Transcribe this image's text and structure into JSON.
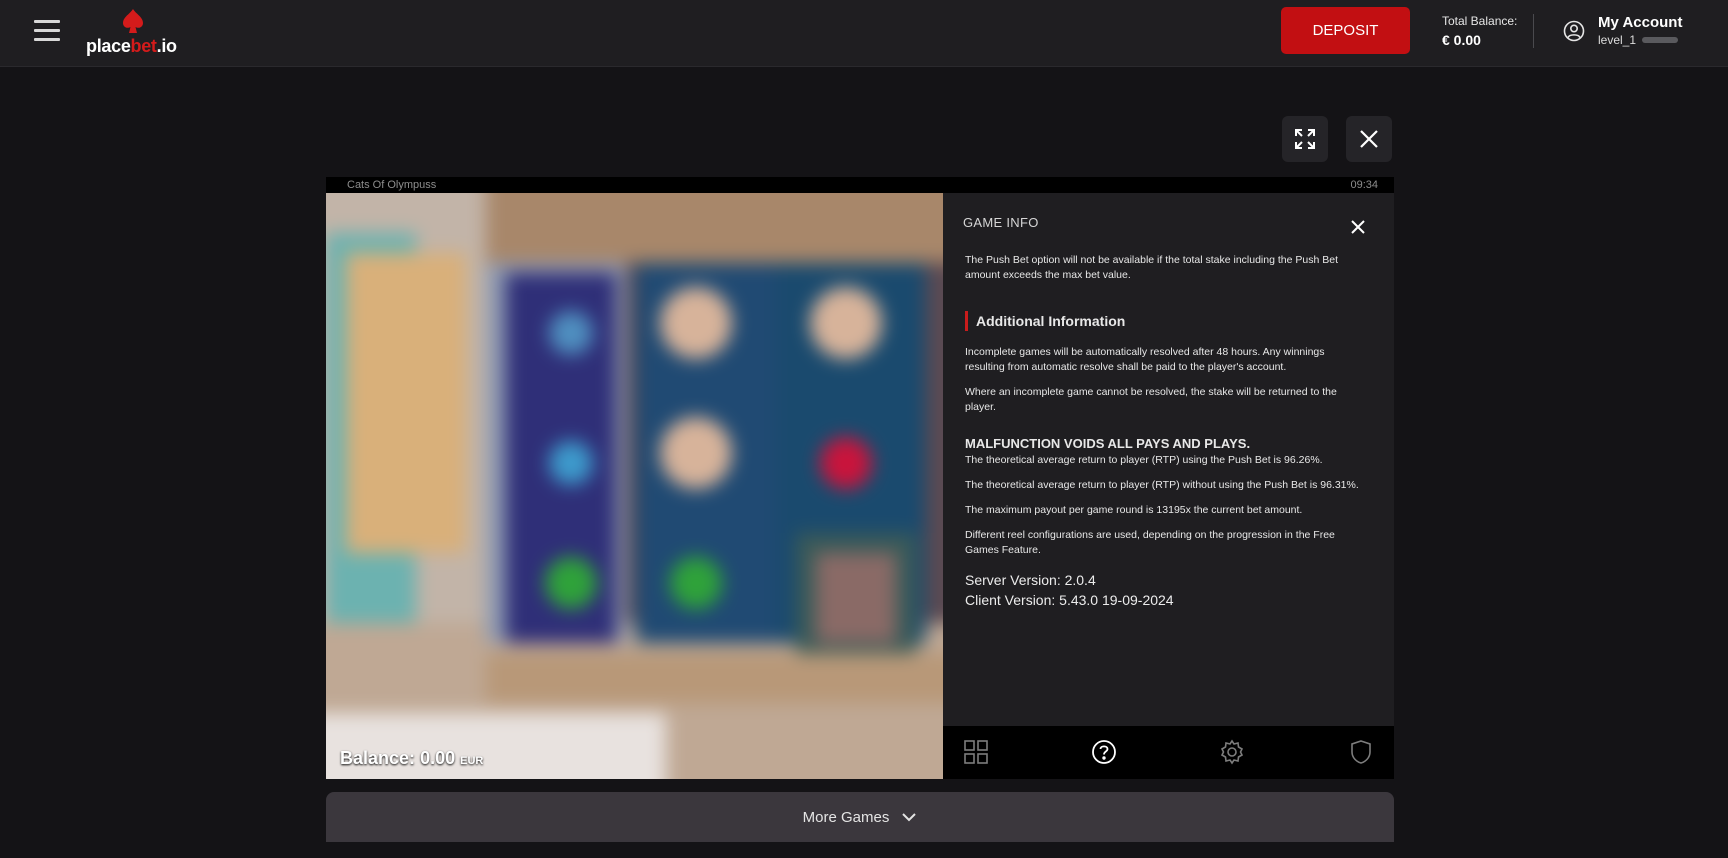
{
  "header": {
    "logo": {
      "text_white": "place",
      "text_red": "bet",
      "text_suffix": ".io"
    },
    "deposit_label": "DEPOSIT",
    "balance_label": "Total Balance:",
    "balance_value": "€ 0.00",
    "account_title": "My Account",
    "account_level": "level_1"
  },
  "game": {
    "title": "Cats Of Olympuss",
    "clock": "09:34",
    "balance_label": "Balance:",
    "balance_value": "0.00",
    "balance_currency": "EUR"
  },
  "info_panel": {
    "title": "GAME INFO",
    "push_bet_note": "The Push Bet option will not be available if the total stake including the Push Bet amount exceeds the max bet value.",
    "section_title": "Additional Information",
    "para_incomplete": "Incomplete games will be automatically resolved after 48 hours. Any winnings resulting from automatic resolve shall be paid to the player's account.",
    "para_unresolved": "Where an incomplete game cannot be resolved, the stake will be returned to the player.",
    "malfunction": "MALFUNCTION VOIDS ALL PAYS AND PLAYS.",
    "rtp_push": "The theoretical average return to player (RTP) using the Push Bet is 96.26%.",
    "rtp_no_push": "The theoretical average return to player (RTP) without using the Push Bet is 96.31%.",
    "max_payout": "The maximum payout per game round is 13195x the current bet amount.",
    "reel_config": "Different reel configurations are used, depending on the progression in the Free Games Feature.",
    "server_version": "Server Version: 2.0.4",
    "client_version": "Client Version: 5.43.0 19-09-2024",
    "tabs": [
      "grid-icon",
      "help-icon",
      "settings-icon",
      "shield-icon"
    ],
    "active_tab": "help-icon"
  },
  "more_games_label": "More Games",
  "colors": {
    "accent_red": "#c20f12",
    "background": "#141316",
    "topbar": "#1f1e21",
    "panel": "#1f1e21"
  }
}
